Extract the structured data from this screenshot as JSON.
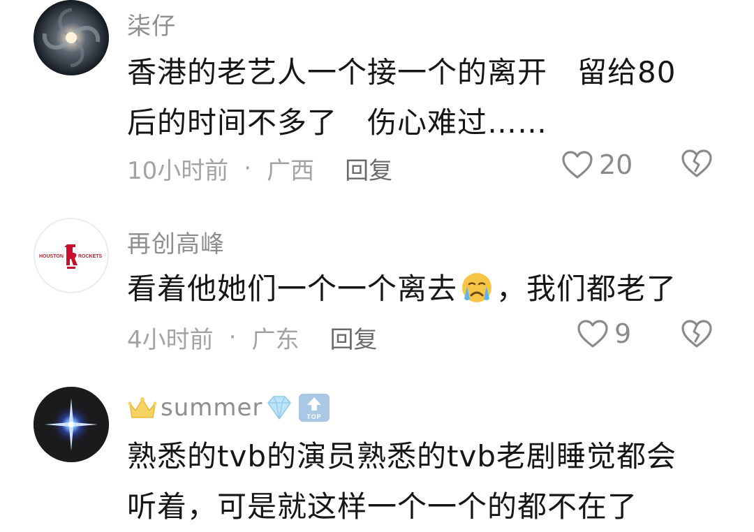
{
  "comments": [
    {
      "username": "柒仔",
      "text_line1": "香港的老艺人一个接一个的离开　留给80",
      "text_line2": "后的时间不多了　伤心难过……",
      "time": "10小时前",
      "separator": "·",
      "location": "广西",
      "reply_label": "回复",
      "likes": "20",
      "avatar_icon": "galaxy-avatar"
    },
    {
      "username": "再创高峰",
      "text_before_emoji": "看着他她们一个一个离去",
      "emoji": "crying-face-emoji",
      "text_after_emoji": "，我们都老了",
      "time": "4小时前",
      "separator": "·",
      "location": "广东",
      "reply_label": "回复",
      "likes": "9",
      "avatar_icon": "houston-rockets-logo",
      "avatar_text_left": "HOUSTON",
      "avatar_text_right": "ROCKETS"
    },
    {
      "username": "summer",
      "badges": [
        "crown-icon",
        "diamond-icon",
        "top-badge-icon"
      ],
      "top_badge_text": "TOP",
      "text_line1": "熟悉的tvb的演员熟悉的tvb老剧睡觉都会",
      "text_line2": "听着，可是就这样一个一个的都不在了",
      "avatar_icon": "star-flare-avatar"
    }
  ]
}
